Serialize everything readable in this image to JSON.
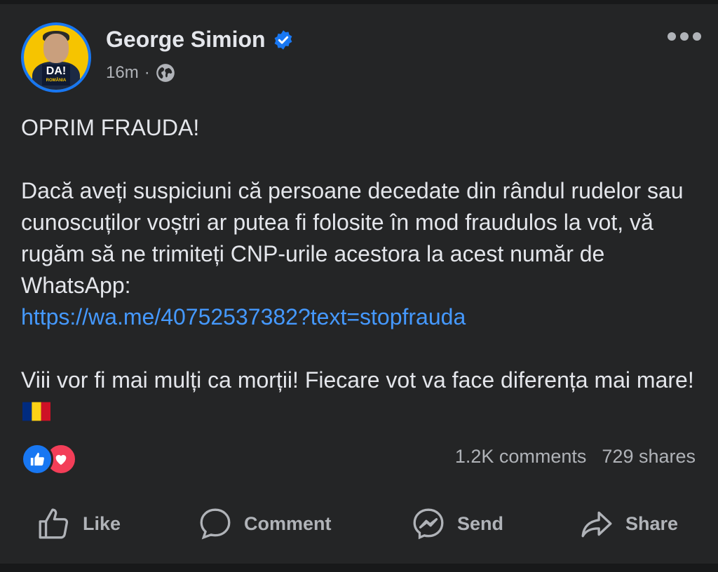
{
  "post": {
    "author": "George Simion",
    "time": "16m",
    "separator": "·",
    "avatar_badge": "DA!",
    "avatar_badge_sub": "ROMÂNIA",
    "paragraphs": {
      "p1": "OPRIM FRAUDA!",
      "p2": "Dacă aveți suspiciuni că persoane decedate din rândul rudelor sau cunoscuților voștri ar putea fi folosite în mod fraudulos la vot, vă rugăm să ne trimiteți CNP-urile acestora la acest număr de WhatsApp:",
      "link": "https://wa.me/40752537382?text=stopfrauda",
      "p3": "Viii vor fi mai mulți ca morții! Fiecare vot va face diferența mai mare!"
    }
  },
  "stats": {
    "comments": "1.2K comments",
    "shares": "729 shares"
  },
  "actions": {
    "like": "Like",
    "comment": "Comment",
    "send": "Send",
    "share": "Share"
  },
  "icons": {
    "verified": "verified-badge-icon",
    "globe": "globe-icon",
    "more": "more-options-icon",
    "flag": "romania-flag-icon"
  },
  "colors": {
    "background": "#242526",
    "text": "#e4e6eb",
    "secondary": "#b0b3b8",
    "link": "#4599ff",
    "accent": "#1877f2",
    "love": "#f33e58"
  }
}
